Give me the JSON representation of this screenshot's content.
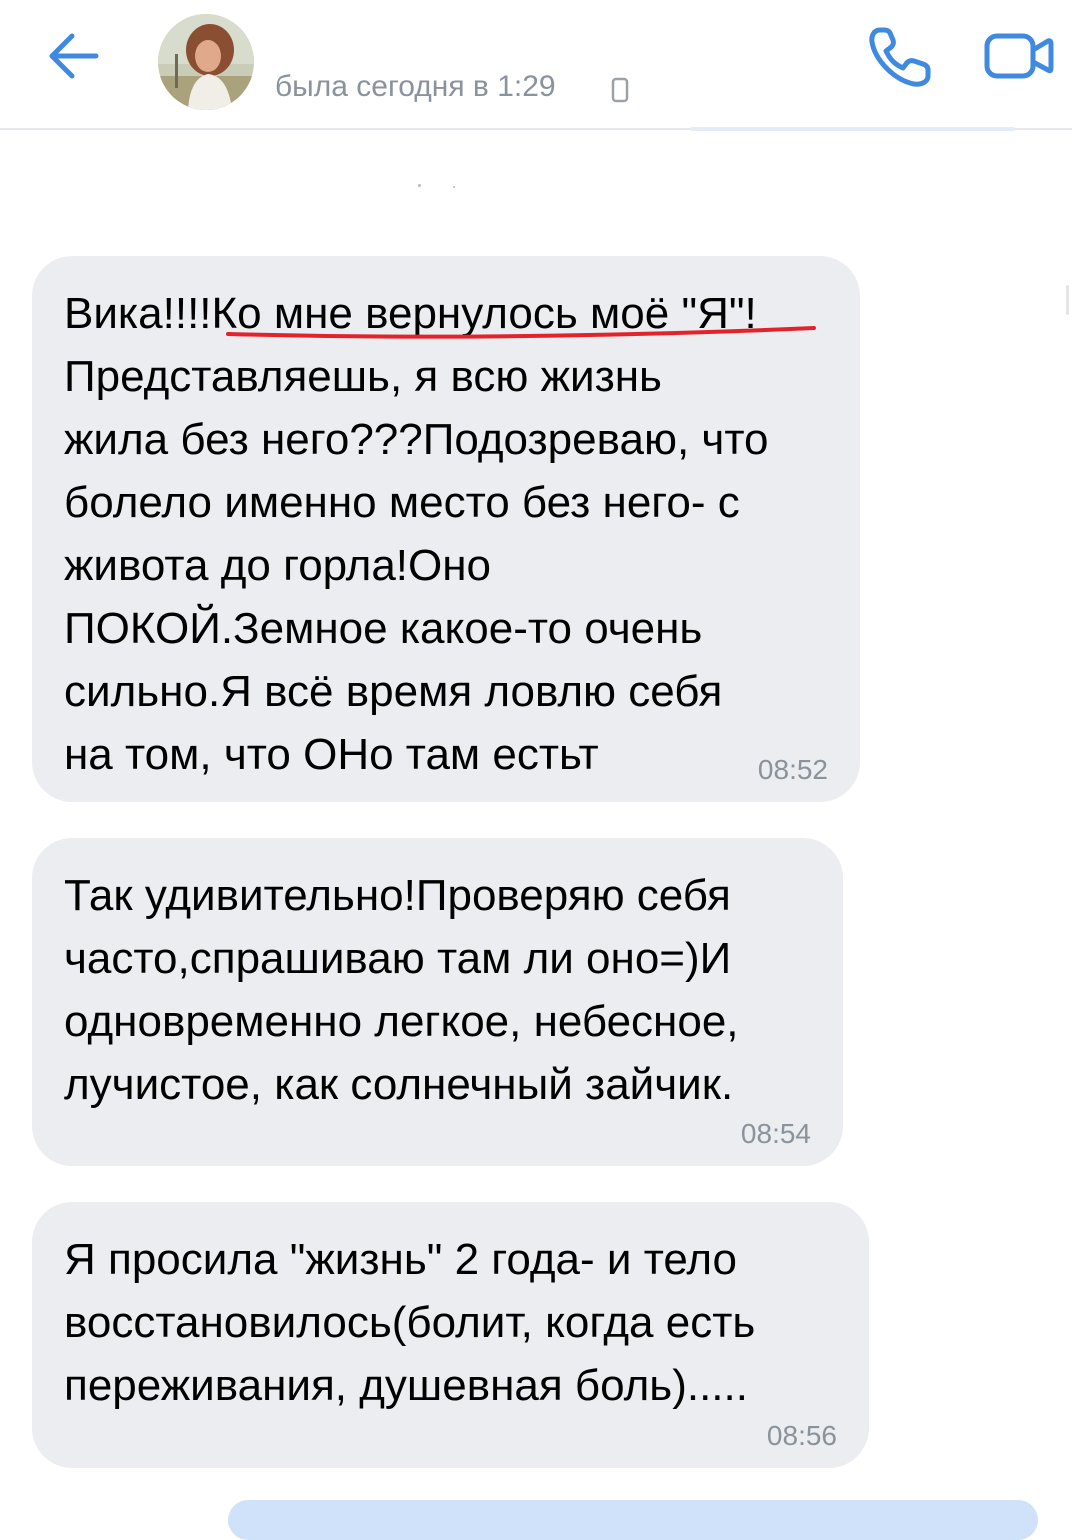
{
  "header": {
    "back_icon": "arrow-left-icon",
    "avatar_alt": "contact-avatar",
    "status": "была сегодня в 1:29",
    "device_icon": "phone-device-icon",
    "call_icon": "phone-call-icon",
    "video_icon": "video-camera-icon",
    "accent_color": "#3f8ae0"
  },
  "messages": [
    {
      "text_first": "Вика!!!!",
      "text_highlight": "Ко мне вернулось моё \"Я\"!",
      "text_rest": "Представляешь, я всю жизнь\nжила без него???Подозреваю, что\nболело именно место без него- с\nживота до горла!Оно\nПОКОЙ.Земное какое-то очень\nсильно.Я всё время ловлю себя\nна том, что ОНо там естьт",
      "time": "08:52",
      "highlight_color": "#e3232c"
    },
    {
      "text": "Так удивительно!Проверяю себя\nчасто,спрашиваю там ли оно=)И\nодновременно легкое, небесное,\nлучистое, как солнечный зайчик.",
      "time": "08:54"
    },
    {
      "text": "Я просила \"жизнь\" 2 года- и тело\nвосстановилось(болит, когда есть\nпереживания, душевная боль).....",
      "time": "08:56"
    }
  ]
}
